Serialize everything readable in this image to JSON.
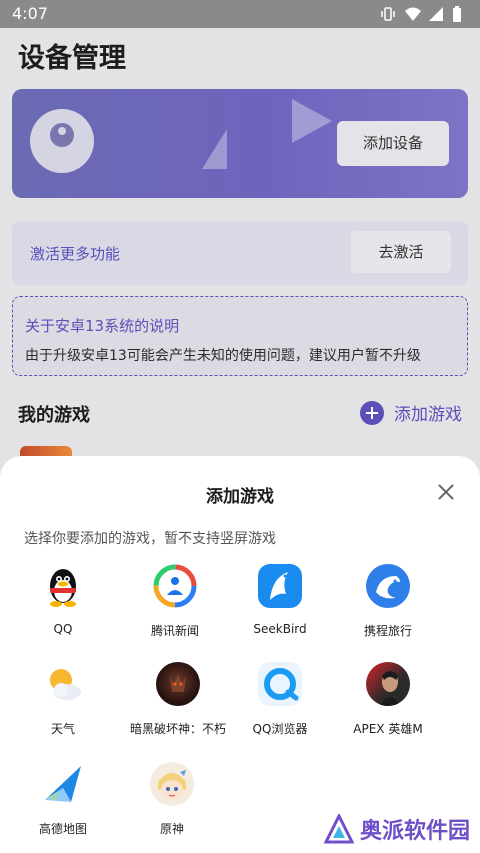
{
  "status_bar": {
    "time": "4:07"
  },
  "page": {
    "title": "设备管理",
    "device_card": {
      "add_device_label": "添加设备"
    },
    "activate_card": {
      "label": "激活更多功能",
      "button": "去激活"
    },
    "notice": {
      "title": "关于安卓13系统的说明",
      "text": "由于升级安卓13可能会产生未知的使用问题，建议用户暂不升级"
    },
    "my_games": {
      "heading": "我的游戏",
      "add_link": "添加游戏"
    }
  },
  "sheet": {
    "title": "添加游戏",
    "hint": "选择你要添加的游戏，暂不支持竖屏游戏",
    "apps": [
      {
        "label": "QQ",
        "icon": "qq-penguin-icon"
      },
      {
        "label": "腾讯新闻",
        "icon": "tencent-news-icon"
      },
      {
        "label": "SeekBird",
        "icon": "seekbird-icon"
      },
      {
        "label": "携程旅行",
        "icon": "ctrip-dolphin-icon"
      },
      {
        "label": "天气",
        "icon": "weather-sun-cloud-icon"
      },
      {
        "label": "暗黑破坏神：不朽",
        "icon": "diablo-immortal-icon"
      },
      {
        "label": "QQ浏览器",
        "icon": "qq-browser-icon"
      },
      {
        "label": "APEX 英雄M",
        "icon": "apex-legends-mobile-icon"
      },
      {
        "label": "高德地图",
        "icon": "amap-icon"
      },
      {
        "label": "原神",
        "icon": "genshin-impact-icon"
      }
    ]
  },
  "watermark": {
    "text": "奥派软件园",
    "sub": "AOPAIRUANJIANYUAN.COM"
  },
  "colors": {
    "accent": "#5b4fb8",
    "card_gradient_start": "#6b6ab3",
    "card_gradient_end": "#7b74c6"
  }
}
